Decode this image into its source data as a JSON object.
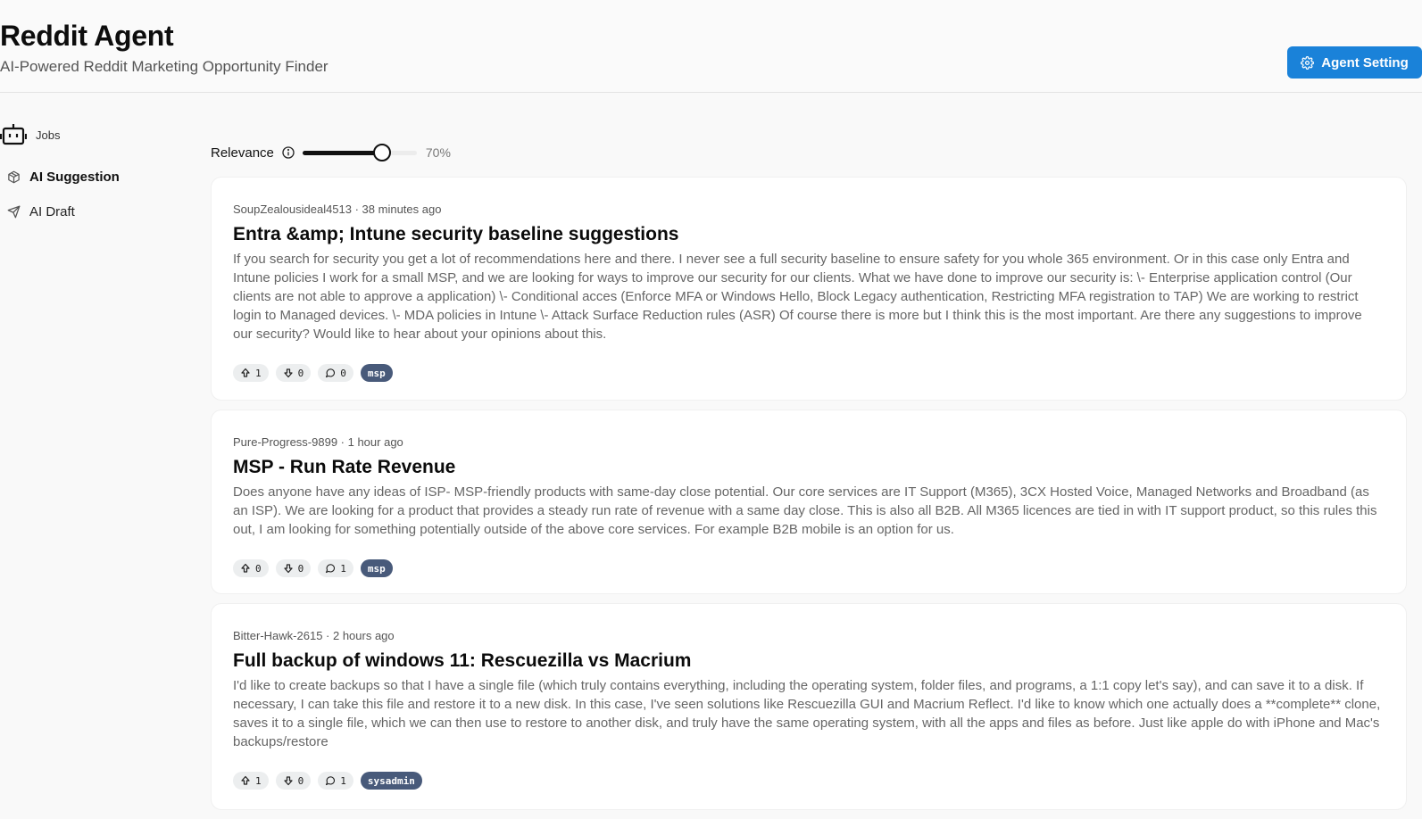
{
  "header": {
    "title": "Reddit Agent",
    "subtitle": "AI-Powered Reddit Marketing Opportunity Finder",
    "agent_setting_label": "Agent Setting"
  },
  "sidebar": {
    "items": [
      {
        "label": "Jobs",
        "icon": "robot-icon"
      },
      {
        "label": "AI Suggestion",
        "icon": "box-icon",
        "active": true
      },
      {
        "label": "AI Draft",
        "icon": "send-icon"
      }
    ]
  },
  "relevance": {
    "label": "Relevance",
    "value": 0.7,
    "value_text": "70%"
  },
  "posts": [
    {
      "meta": "SoupZealousideal4513 · 38 minutes ago",
      "title": "Entra &amp; Intune security baseline suggestions",
      "body": "If you search for security you get a lot of recommendations here and there. I never see a full security baseline to ensure safety for you whole 365 environment. Or in this case only Entra and Intune policies I work for a small MSP, and we are looking for ways to improve our security for our clients. What we have done to improve our security is: \\- Enterprise application control (Our clients are not able to approve a application) \\- Conditional acces (Enforce MFA or Windows Hello, Block Legacy authentication, Restricting MFA registration to TAP) We are working to restrict login to Managed devices. \\- MDA policies in Intune \\- Attack Surface Reduction rules (ASR) Of course there is more but I think this is the most important. Are there any suggestions to improve our security? Would like to hear about your opinions about this.",
      "upvotes": "1",
      "downvotes": "0",
      "comments": "0",
      "tag": "msp"
    },
    {
      "meta": "Pure-Progress-9899 · 1 hour ago",
      "title": "MSP - Run Rate Revenue",
      "body": "Does anyone have any ideas of ISP- MSP-friendly products with same-day close potential. Our core services are IT Support (M365), 3CX Hosted Voice, Managed Networks and Broadband (as an ISP). We are looking for a product that provides a steady run rate of revenue with a same day close. This is also all B2B. All M365 licences are tied in with IT support product, so this rules this out, I am looking for something potentially outside of the above core services. For example B2B mobile is an option for us.",
      "upvotes": "0",
      "downvotes": "0",
      "comments": "1",
      "tag": "msp"
    },
    {
      "meta": "Bitter-Hawk-2615 · 2 hours ago",
      "title": "Full backup of windows 11: Rescuezilla vs Macrium",
      "body": "I'd like to create backups so that I have a single file (which truly contains everything, including the operating system, folder files, and programs, a 1:1 copy let's say), and can save it to a disk. If necessary, I can take this file and restore it to a new disk. In this case, I've seen solutions like Rescuezilla GUI and Macrium Reflect. I'd like to know which one actually does a **complete** clone, saves it to a single file, which we can then use to restore to another disk, and truly have the same operating system, with all the apps and files as before. Just like apple do with iPhone and Mac's backups/restore",
      "upvotes": "1",
      "downvotes": "0",
      "comments": "1",
      "tag": "sysadmin"
    }
  ],
  "colors": {
    "accent": "#1a82d9",
    "tag_bg": "#485a7a"
  }
}
